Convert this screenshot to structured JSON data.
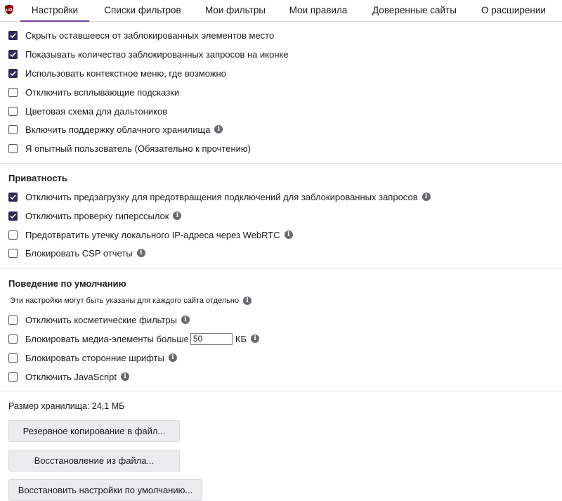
{
  "tabs": [
    {
      "label": "Настройки",
      "active": true
    },
    {
      "label": "Списки фильтров",
      "active": false
    },
    {
      "label": "Мои фильтры",
      "active": false
    },
    {
      "label": "Мои правила",
      "active": false
    },
    {
      "label": "Доверенные сайты",
      "active": false
    },
    {
      "label": "О расширении",
      "active": false
    }
  ],
  "general": [
    {
      "label": "Скрыть оставшееся от заблокированных элементов место",
      "checked": true,
      "info": false
    },
    {
      "label": "Показывать количество заблокированных запросов на иконке",
      "checked": true,
      "info": false
    },
    {
      "label": "Использовать контекстное меню, где возможно",
      "checked": true,
      "info": false
    },
    {
      "label": "Отключить всплывающие подсказки",
      "checked": false,
      "info": false
    },
    {
      "label": "Цветовая схема для дальтоников",
      "checked": false,
      "info": false
    },
    {
      "label": "Включить поддержку облачного хранилища",
      "checked": false,
      "info": true
    },
    {
      "label": "Я опытный пользователь (Обязательно к прочтению)",
      "checked": false,
      "info": false
    }
  ],
  "privacy": {
    "heading": "Приватность",
    "items": [
      {
        "label": "Отключить предзагрузку для предотвращения подключений для заблокированных запросов",
        "checked": true,
        "info": true
      },
      {
        "label": "Отключить проверку гиперссылок",
        "checked": true,
        "info": true
      },
      {
        "label": "Предотвратить утечку локального IP-адреса через WebRTC",
        "checked": false,
        "info": true
      },
      {
        "label": "Блокировать CSP отчеты",
        "checked": false,
        "info": true
      }
    ]
  },
  "defaults": {
    "heading": "Поведение по умолчанию",
    "note": "Эти настройки могут быть указаны для каждого сайта отдельно",
    "cosmetic": {
      "label": "Отключить косметические фильтры",
      "checked": false
    },
    "media": {
      "label": "Блокировать медиа-элементы больше",
      "checked": false,
      "value": "50",
      "unit": "КБ"
    },
    "fonts": {
      "label": "Блокировать сторонние шрифты",
      "checked": false
    },
    "javascript": {
      "label": "Отключить JavaScript",
      "checked": false
    }
  },
  "storage": {
    "label": "Размер хранилища: 24,1 МБ"
  },
  "buttons": {
    "backup": "Резервное копирование в файл...",
    "restore": "Восстановление из файла...",
    "reset": "Восстановить настройки по умолчанию..."
  },
  "info_glyph": "i",
  "colors": {
    "accent": "#6d40a3",
    "checkbox_checked": "#2f2a57",
    "logo": "#800000"
  }
}
